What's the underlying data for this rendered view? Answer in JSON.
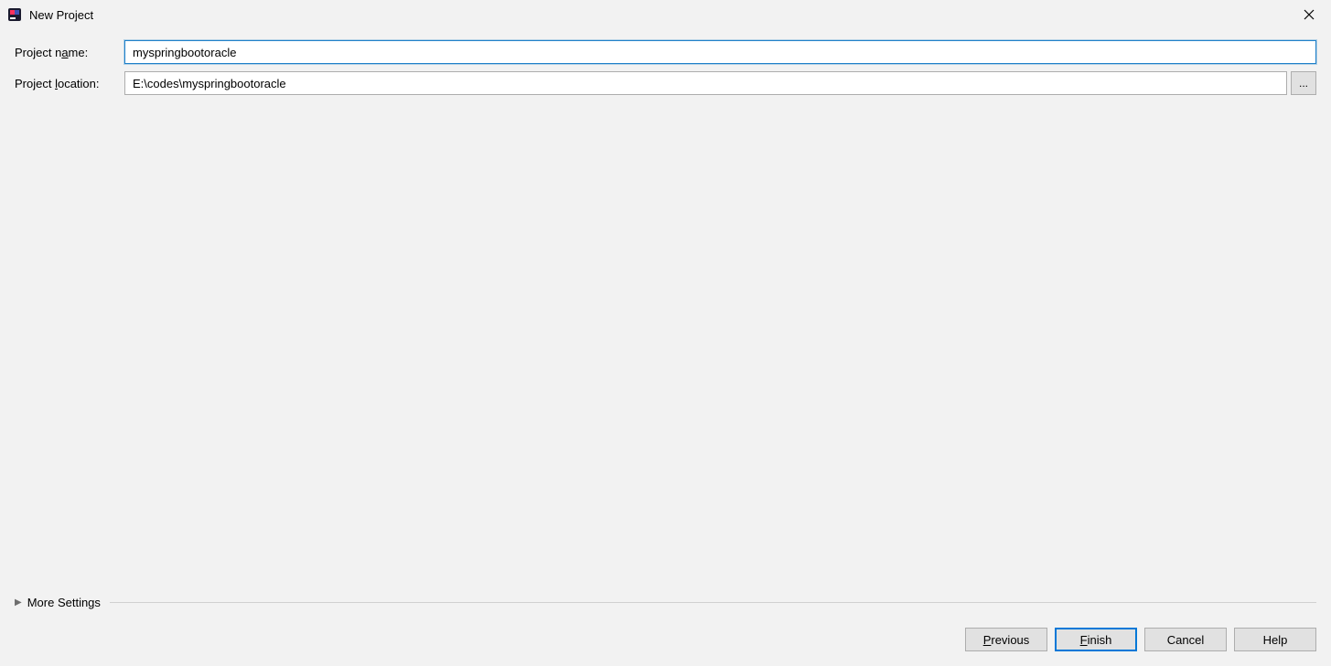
{
  "window": {
    "title": "New Project"
  },
  "form": {
    "projectName": {
      "label_pre": "Project n",
      "label_mnemonic": "a",
      "label_post": "me:",
      "value": "myspringbootoracle"
    },
    "projectLocation": {
      "label_pre": "Project ",
      "label_mnemonic": "l",
      "label_post": "ocation:",
      "value": "E:\\codes\\myspringbootoracle",
      "browse": "..."
    }
  },
  "moreSettings": {
    "label_pre": "Mor",
    "label_mnemonic": "e",
    "label_post": " Settings"
  },
  "buttons": {
    "previous": {
      "mnemonic": "P",
      "rest": "revious"
    },
    "finish": {
      "mnemonic": "F",
      "rest": "inish"
    },
    "cancel": {
      "text": "Cancel"
    },
    "help": {
      "text": "Help"
    }
  }
}
